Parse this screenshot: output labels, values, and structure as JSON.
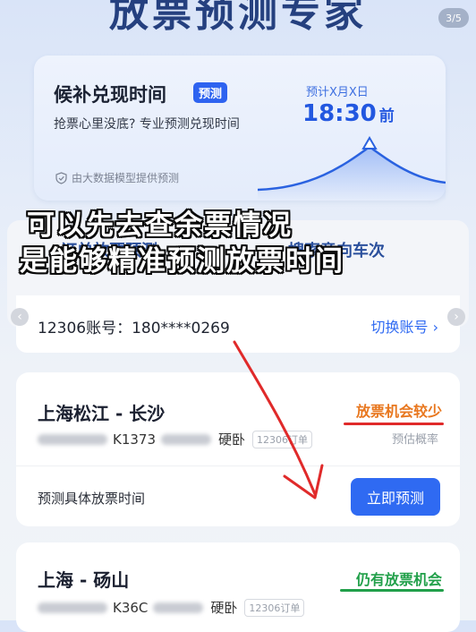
{
  "header": {
    "title": "放票预测专家",
    "page_indicator": "3/5"
  },
  "prediction_card": {
    "title": "候补兑现时间",
    "tag": "预测",
    "subtitle": "抢票心里没底? 专业预测兑现时间",
    "estimate_label": "预计X月X日",
    "time": "18:30",
    "time_suffix": "前",
    "note": "由大数据模型提供预测"
  },
  "captions": {
    "line1": "可以先去查余票情况",
    "line2": "是能够精准预测放票时间"
  },
  "tabs": {
    "left": "订单放票预测",
    "right": "搜索意向车次"
  },
  "account": {
    "label": "12306账号：",
    "value": "180****0269",
    "switch_label": "切换账号 ›"
  },
  "trains": [
    {
      "route": "上海松江 - 长沙",
      "train_no": "K1373",
      "seat": "硬卧",
      "order_tag": "12306订单",
      "chance": "放票机会较少",
      "chance_color": "#e8771e",
      "prob_label": "预估概率",
      "predict_label": "预测具体放票时间",
      "predict_button": "立即预测"
    },
    {
      "route": "上海 - 砀山",
      "train_no": "K36C",
      "seat": "硬卧",
      "order_tag": "12306订单",
      "chance": "仍有放票机会",
      "chance_color": "#22a04a"
    }
  ],
  "colors": {
    "accent": "#2f6af2",
    "annotation_red": "#e02a2a"
  }
}
